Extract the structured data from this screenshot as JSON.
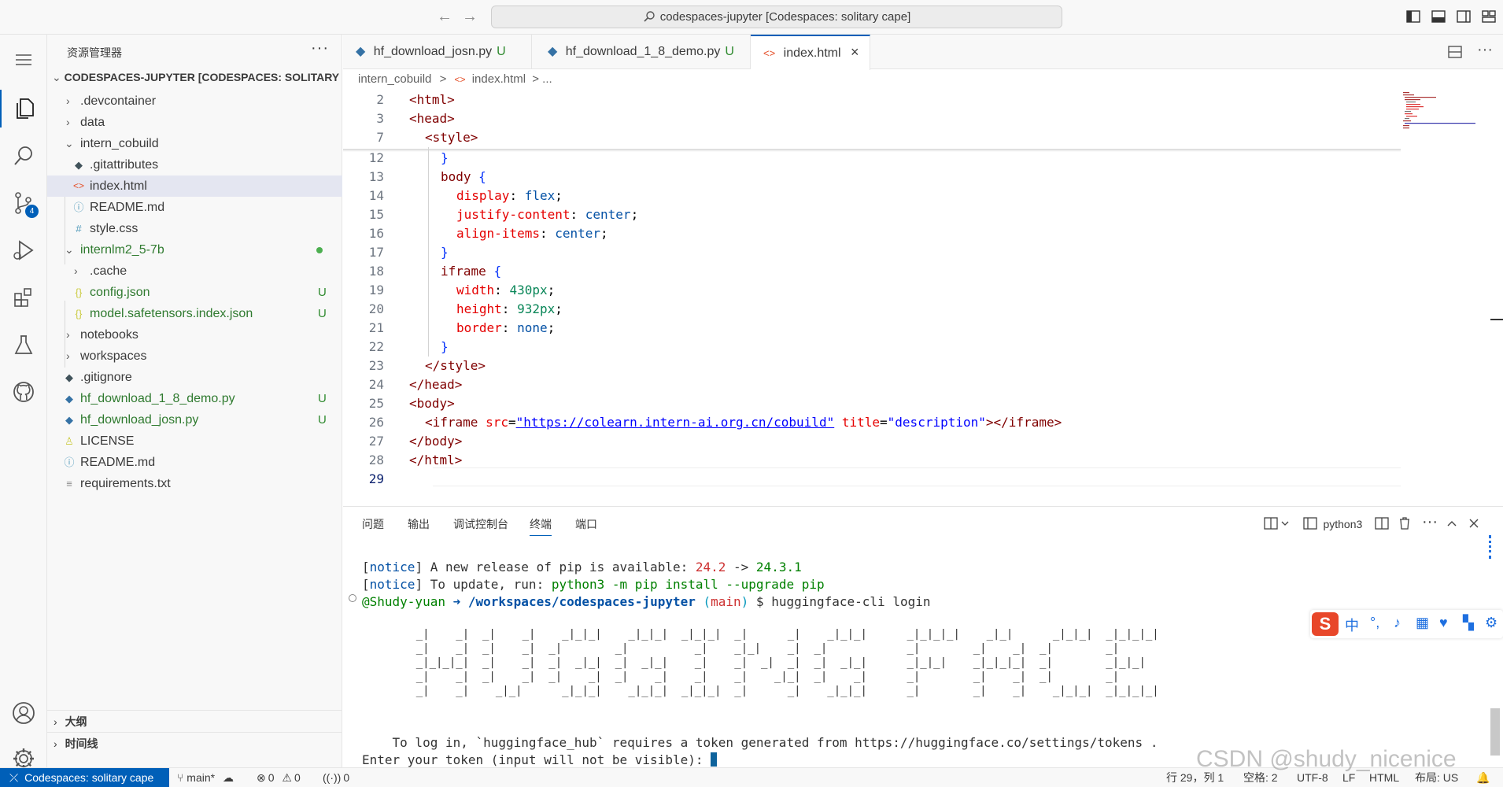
{
  "titlebar": {
    "command_center": "codespaces-jupyter [Codespaces: solitary cape]"
  },
  "activity_bar": {
    "source_control_badge": "4"
  },
  "sidebar": {
    "title": "资源管理器",
    "more": "···",
    "root": "CODESPACES-JUPYTER [CODESPACES: SOLITARY CA...",
    "items": [
      {
        "label": ".devcontainer",
        "icon": "folder"
      },
      {
        "label": "data",
        "icon": "folder"
      },
      {
        "label": "intern_cobuild",
        "icon": "folder-open"
      },
      {
        "label": ".gitattributes",
        "icon": "git-icon"
      },
      {
        "label": "index.html",
        "icon": "html-icon"
      },
      {
        "label": "README.md",
        "icon": "info-icon"
      },
      {
        "label": "style.css",
        "icon": "hash-icon"
      },
      {
        "label": "internlm2_5-7b",
        "icon": "folder-open"
      },
      {
        "label": ".cache",
        "icon": "folder"
      },
      {
        "label": "config.json",
        "icon": "json-icon",
        "status": "U"
      },
      {
        "label": "model.safetensors.index.json",
        "icon": "json-icon",
        "status": "U"
      },
      {
        "label": "notebooks",
        "icon": "folder"
      },
      {
        "label": "workspaces",
        "icon": "folder"
      },
      {
        "label": ".gitignore",
        "icon": "git-icon"
      },
      {
        "label": "hf_download_1_8_demo.py",
        "icon": "python-icon",
        "status": "U"
      },
      {
        "label": "hf_download_josn.py",
        "icon": "python-icon",
        "status": "U"
      },
      {
        "label": "LICENSE",
        "icon": "license-icon"
      },
      {
        "label": "README.md",
        "icon": "info-icon"
      },
      {
        "label": "requirements.txt",
        "icon": "lines-icon"
      }
    ],
    "outline": "大纲",
    "timeline": "时间线"
  },
  "tabs": [
    {
      "label": "hf_download_josn.py",
      "status": "U"
    },
    {
      "label": "hf_download_1_8_demo.py",
      "status": "U"
    },
    {
      "label": "index.html",
      "status": ""
    }
  ],
  "breadcrumb": {
    "folder": "intern_cobuild",
    "sep": ">",
    "file": "index.html",
    "tail": "> ..."
  },
  "editor": {
    "line_numbers": [
      "2",
      "3",
      "7",
      "12",
      "13",
      "14",
      "15",
      "16",
      "17",
      "18",
      "19",
      "20",
      "21",
      "22",
      "23",
      "24",
      "25",
      "26",
      "27",
      "28",
      "29"
    ],
    "sticky": {
      "l2": "<html>",
      "l3": "<head>",
      "l7": "<style>"
    },
    "code": {
      "l12": "}",
      "body_sel": "body",
      "open_brace": "{",
      "display_prop": "display",
      "display_val": "flex",
      "jc_prop": "justify-content",
      "jc_val": "center",
      "ai_prop": "align-items",
      "ai_val": "center",
      "close_brace": "}",
      "iframe_sel": "iframe",
      "width_prop": "width",
      "width_val": "430px",
      "height_prop": "height",
      "height_val": "932px",
      "border_prop": "border",
      "border_val": "none",
      "end_style": "</style>",
      "end_head": "</head>",
      "body_open": "<body>",
      "iframe_open": "<iframe",
      "src_attr": "src",
      "src_val": "\"https://colearn.intern-ai.org.cn/cobuild\"",
      "title_attr": "title",
      "title_val": "\"description\"",
      "iframe_close": "></iframe>",
      "body_close": "</body>",
      "html_close": "</html>"
    }
  },
  "panel": {
    "tabs": [
      "问题",
      "输出",
      "调试控制台",
      "终端",
      "端口"
    ],
    "active_tab": "终端",
    "terminal_name": "python3"
  },
  "terminal": {
    "notice_tag": "notice",
    "line1_a": "A new release of pip is available: ",
    "line1_old": "24.2",
    "line1_arrow": " -> ",
    "line1_new": "24.3.1",
    "line2_a": "To update, run: ",
    "line2_cmd": "python3 -m pip install --upgrade pip",
    "prompt_user": "@Shudy-yuan",
    "prompt_path": "➜ /workspaces/codespaces-jupyter",
    "prompt_branch_open": " (",
    "prompt_branch": "main",
    "prompt_branch_close": ")",
    "prompt_cmd": " $ huggingface-cli login",
    "ascii_art": "    _|    _|  _|    _|    _|_|_|    _|_|_|  _|_|_|  _|      _|    _|_|_|      _|_|_|_|    _|_|      _|_|_|  _|_|_|_|\n    _|    _|  _|    _|  _|        _|          _|    _|_|    _|  _|            _|        _|    _|  _|        _|\n    _|_|_|_|  _|    _|  _|  _|_|  _|  _|_|    _|    _|  _|  _|  _|  _|_|      _|_|_|    _|_|_|_|  _|        _|_|_|\n    _|    _|  _|    _|  _|    _|  _|    _|    _|    _|    _|_|  _|    _|      _|        _|    _|  _|        _|\n    _|    _|    _|_|      _|_|_|    _|_|_|  _|_|_|  _|      _|    _|_|_|      _|        _|    _|    _|_|_|  _|_|_|_|",
    "login_line": "    To log in, `huggingface_hub` requires a token generated from https://huggingface.co/settings/tokens .",
    "token_line": "Enter your token (input will not be visible): "
  },
  "ime": {
    "logo": "S",
    "lang": "中"
  },
  "statusbar": {
    "remote": "Codespaces: solitary cape",
    "branch": "main*",
    "errors": "0",
    "warnings": "0",
    "ports": "0",
    "position": "行 29，列 1",
    "spaces": "空格: 2",
    "encoding": "UTF-8",
    "eol": "LF",
    "language": "HTML",
    "layout": "布局: US"
  },
  "watermark": "CSDN @shudy_nicenice"
}
